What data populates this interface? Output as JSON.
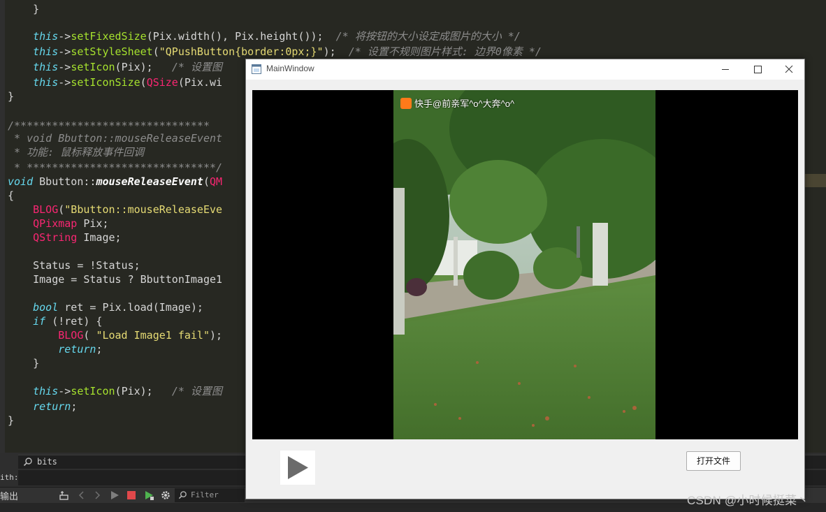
{
  "editor": {
    "lines": [
      [
        "    }"
      ],
      [
        ""
      ],
      [
        "    this->setFixedSize(Pix.width(), Pix.height());  /* 将按钮的大小设定成图片的大小 */"
      ],
      [
        "    this->setStyleSheet(\"QPushButton{border:0px;}\");  /* 设置不规则图片样式: 边界0像素 */"
      ],
      [
        "    this->setIcon(Pix);   /* 设置图"
      ],
      [
        "    this->setIconSize(QSize(Pix.wi"
      ],
      [
        "}"
      ],
      [
        ""
      ],
      [
        "/*******************************"
      ],
      [
        " * void Bbutton::mouseReleaseEvent"
      ],
      [
        " * 功能: 鼠标释放事件回调"
      ],
      [
        " * ******************************/"
      ],
      [
        "void Bbutton::mouseReleaseEvent(QM"
      ],
      [
        "{"
      ],
      [
        "    BLOG(\"Bbutton::mouseReleaseEve"
      ],
      [
        "    QPixmap Pix;"
      ],
      [
        "    QString Image;"
      ],
      [
        ""
      ],
      [
        "    Status = !Status;"
      ],
      [
        "    Image = Status ? BbuttonImage1"
      ],
      [
        ""
      ],
      [
        "    bool ret = Pix.load(Image);"
      ],
      [
        "    if (!ret) {"
      ],
      [
        "        BLOG( \"Load Image1 fail\");"
      ],
      [
        "        return;"
      ],
      [
        "    }"
      ],
      [
        ""
      ],
      [
        "    this->setIcon(Pix);   /* 设置图"
      ],
      [
        "    return;"
      ],
      [
        "}"
      ]
    ]
  },
  "ide": {
    "search_value": "bits",
    "width_label": "ith:",
    "output_label": "输出",
    "filter_placeholder": "Filter",
    "watermark": "CSDN @小时候挺菜丶"
  },
  "window": {
    "title": "MainWindow",
    "video_overlay_text": "快手@前亲军^o^大奔^o^",
    "open_file_button": "打开文件"
  },
  "colors": {
    "editor_bg": "#272822",
    "window_bg": "#f0f0f0",
    "video_bg": "#000000"
  }
}
